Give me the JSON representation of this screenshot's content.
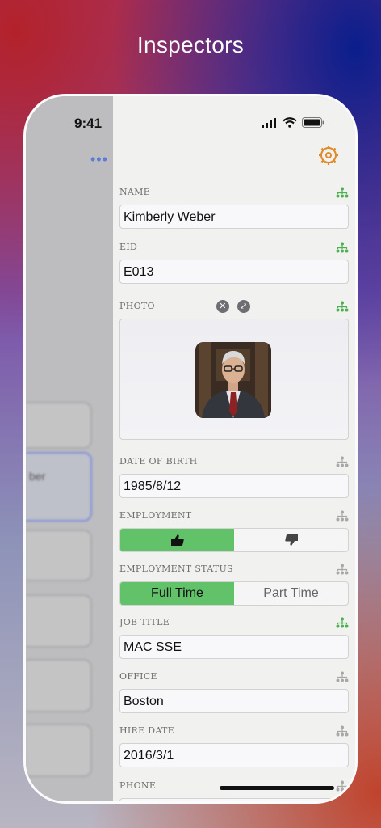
{
  "headline": "Inspectors",
  "status": {
    "time": "9:41"
  },
  "sidebar": {
    "more_label": "•••",
    "ghost_text": "ber"
  },
  "colors": {
    "accent_orange": "#e08a2c",
    "toggle_green": "#62c26a",
    "tree_green": "#4caf50",
    "tree_gray": "#a8a8a8"
  },
  "inspector": {
    "fields": [
      {
        "label": "NAME",
        "value": "Kimberly Weber",
        "type": "text",
        "linked": true
      },
      {
        "label": "EID",
        "value": "E013",
        "type": "text",
        "linked": true
      },
      {
        "label": "PHOTO",
        "type": "photo",
        "linked": true
      },
      {
        "label": "DATE OF BIRTH",
        "value": "1985/8/12",
        "type": "text",
        "linked": false
      },
      {
        "label": "EMPLOYMENT",
        "type": "bool",
        "options": [
          "thumbs-up-icon",
          "thumbs-down-icon"
        ],
        "selected": 0,
        "linked": false
      },
      {
        "label": "EMPLOYMENT STATUS",
        "type": "segment",
        "options": [
          "Full Time",
          "Part Time"
        ],
        "selected": 0,
        "linked": false
      },
      {
        "label": "JOB TITLE",
        "value": "MAC SSE",
        "type": "text",
        "linked": true
      },
      {
        "label": "OFFICE",
        "value": "Boston",
        "type": "text",
        "linked": false
      },
      {
        "label": "HIRE DATE",
        "value": "2016/3/1",
        "type": "text",
        "linked": false
      },
      {
        "label": "PHONE",
        "type": "text",
        "linked": false
      }
    ]
  }
}
